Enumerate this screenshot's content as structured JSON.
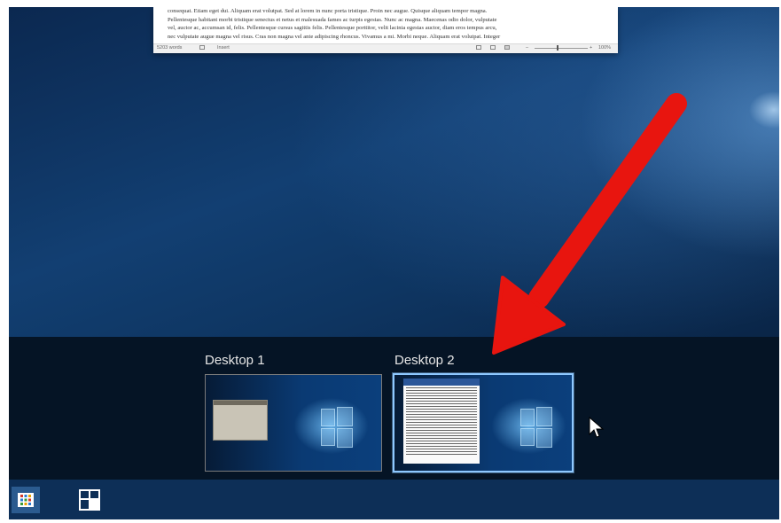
{
  "document_window": {
    "text_lines": [
      "consequat. Etiam eget dui. Aliquam erat volutpat. Sed at lorem in nunc porta tristique. Proin nec augue. Quisque aliquam tempor magna.",
      "Pellentesque habitant morbi tristique senectus et netus et malesuada fames ac turpis egestas. Nunc ac magna. Maecenas odio dolor, vulputate",
      "vel, auctor ac, accumsan id, felis. Pellentesque cursus sagittis felis. Pellentesque porttitor, velit lacinia egestas auctor, diam eros tempus arcu,",
      "nec vulputate augue magna vel risus. Cras non magna vel ante adipiscing rhoncus. Vivamus a mi. Morbi neque. Aliquam erat volutpat. Integer"
    ],
    "status_words": "5203 words",
    "status_mode": "Insert",
    "zoom": "100%"
  },
  "task_view": {
    "desktops": [
      {
        "label": "Desktop 1"
      },
      {
        "label": "Desktop 2"
      }
    ],
    "selected": "Desktop 2"
  },
  "taskbar": {
    "items": [
      {
        "icon": "start-apps-icon"
      },
      {
        "icon": "task-view-icon"
      }
    ]
  },
  "colors": {
    "arrow": "#e8150f",
    "selected_border": "#8ec8ff",
    "taskbar": "#0d2f57"
  }
}
